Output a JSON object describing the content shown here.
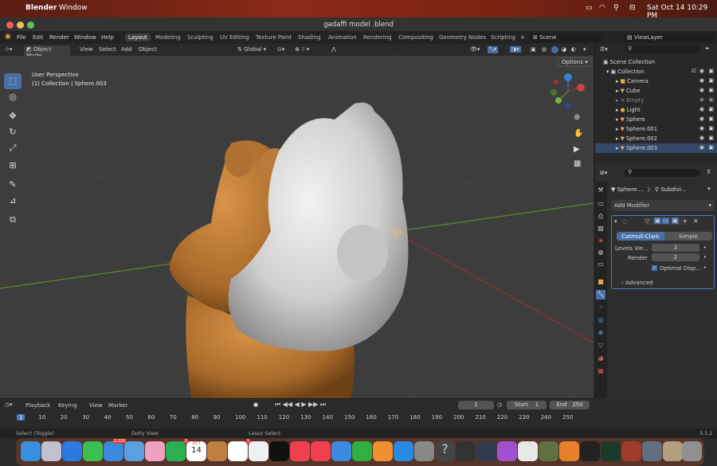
{
  "macos": {
    "app": "Blender",
    "menu": "Window",
    "datetime": "Sat Oct 14  10:29 PM"
  },
  "window": {
    "title": "gadaffi model .blend"
  },
  "menu": [
    "File",
    "Edit",
    "Render",
    "Window",
    "Help"
  ],
  "workspaces": [
    "Layout",
    "Modeling",
    "Sculpting",
    "UV Editing",
    "Texture Paint",
    "Shading",
    "Animation",
    "Rendering",
    "Compositing",
    "Geometry Nodes",
    "Scripting"
  ],
  "scene": "Scene",
  "view_layer": "ViewLayer",
  "viewport_header": {
    "mode": "Object Mode",
    "view": "View",
    "select": "Select",
    "add": "Add",
    "object": "Object",
    "orientation": "Global",
    "options": "Options"
  },
  "viewport_info": {
    "perspective": "User Perspective",
    "collection": "(1) Collection | Sphere.003"
  },
  "outliner": {
    "root": "Scene Collection",
    "collection": "Collection",
    "items": [
      {
        "name": "Camera",
        "color": "#e0b040"
      },
      {
        "name": "Cube",
        "color": "#f0a060"
      },
      {
        "name": "Empty",
        "color": "#888888"
      },
      {
        "name": "Light",
        "color": "#e0b040"
      },
      {
        "name": "Sphere",
        "color": "#f0a060"
      },
      {
        "name": "Sphere.001",
        "color": "#f0a060"
      },
      {
        "name": "Sphere.002",
        "color": "#f0a060"
      },
      {
        "name": "Sphere.003",
        "color": "#f0a060"
      }
    ]
  },
  "properties": {
    "breadcrumb_object": "Sphere....",
    "breadcrumb_mod": "Subdivi...",
    "add_modifier": "Add Modifier",
    "tab_catmull": "Catmull-Clark",
    "tab_simple": "Simple",
    "levels_label": "Levels Vie...",
    "levels_value": "2",
    "render_label": "Render",
    "render_value": "2",
    "optimal_label": "Optimal Disp...",
    "advanced": "Advanced"
  },
  "timeline": {
    "playback": "Playback",
    "keying": "Keying",
    "view": "View",
    "marker": "Marker",
    "current_frame": "1",
    "start_label": "Start",
    "start": "1",
    "end_label": "End",
    "end": "250",
    "ticks": [
      "1",
      "10",
      "20",
      "30",
      "40",
      "50",
      "60",
      "70",
      "80",
      "90",
      "100",
      "110",
      "120",
      "130",
      "140",
      "150",
      "160",
      "170",
      "180",
      "190",
      "200",
      "210",
      "220",
      "230",
      "240",
      "250"
    ]
  },
  "statusbar": {
    "select": "Select (Toggle)",
    "dolly": "Dolly View",
    "lasso": "Lasso Select",
    "version": "3.5.1"
  },
  "dock": {
    "mail_badge": "2,226",
    "messages_badge": "2",
    "calendar_month": "OCT",
    "calendar_day": "14",
    "reminders_badge": "1"
  }
}
